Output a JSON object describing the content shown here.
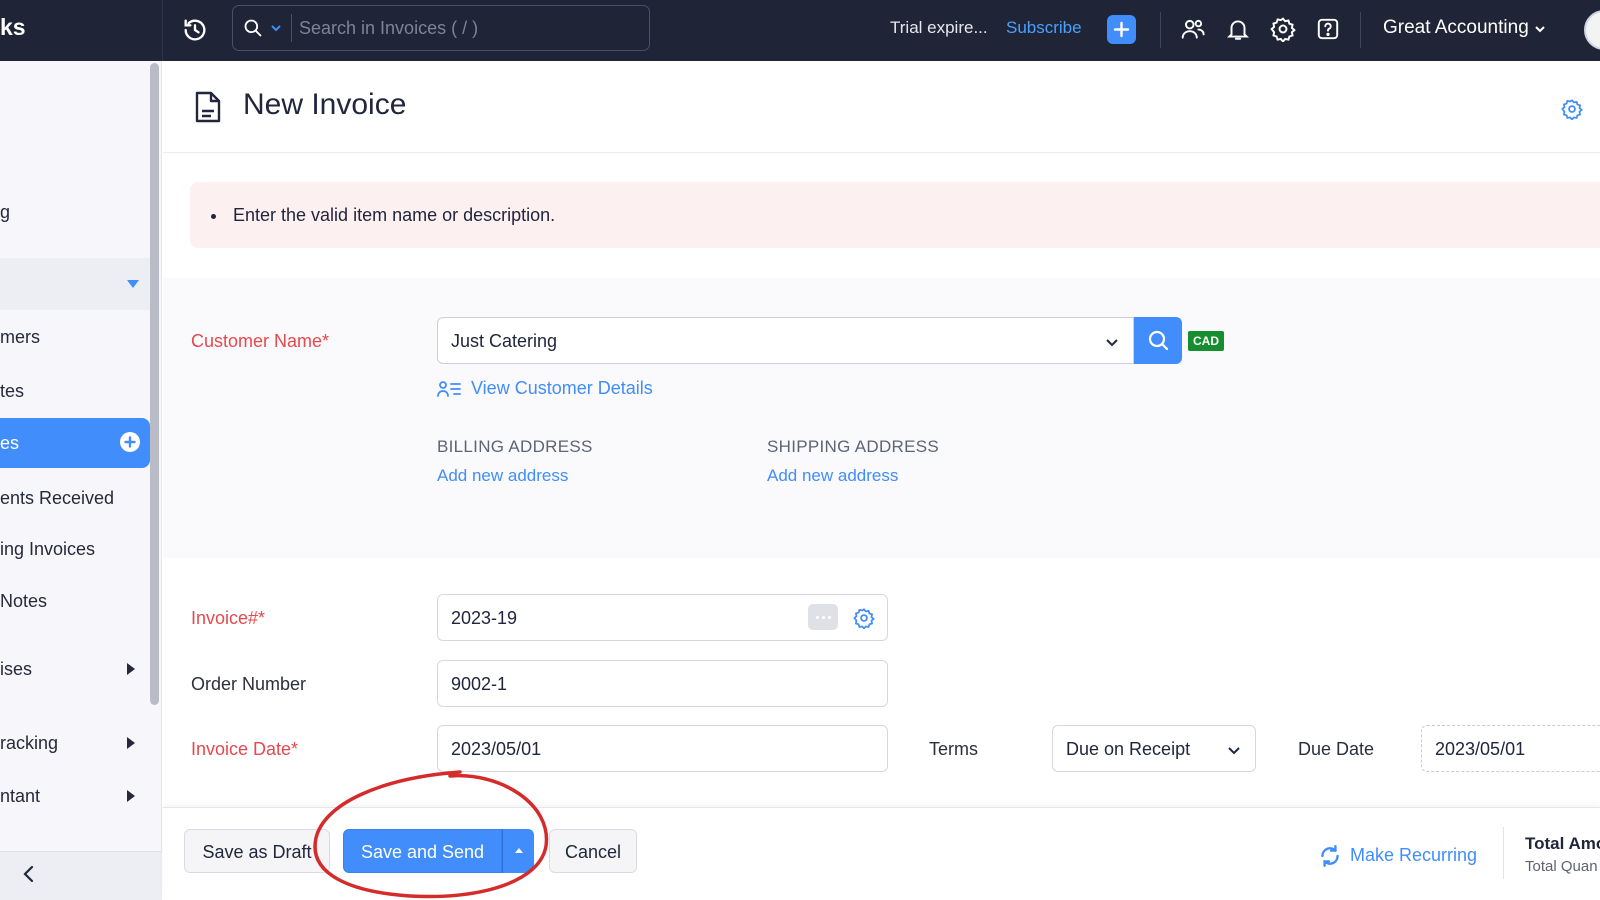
{
  "topbar": {
    "brand": "ks",
    "search_placeholder": "Search in Invoices ( / )",
    "trial_text": "Trial expire...",
    "subscribe_label": "Subscribe",
    "org_name": "Great Accounting"
  },
  "sidebar": {
    "items": [
      {
        "label": "g"
      },
      {
        "label": "mers"
      },
      {
        "label": "tes"
      },
      {
        "label": "es"
      },
      {
        "label": "ents Received"
      },
      {
        "label": "ing Invoices"
      },
      {
        "label": " Notes"
      },
      {
        "label": "ises"
      },
      {
        "label": "racking"
      },
      {
        "label": "ntant"
      }
    ]
  },
  "page": {
    "title": "New Invoice",
    "error_message": "Enter the valid item name or description."
  },
  "customer": {
    "label": "Customer Name*",
    "value": "Just Catering",
    "currency": "CAD",
    "view_details_label": "View Customer Details",
    "billing_title": "BILLING ADDRESS",
    "billing_link": "Add new address",
    "shipping_title": "SHIPPING ADDRESS",
    "shipping_link": "Add new address"
  },
  "invoice": {
    "number_label": "Invoice#*",
    "number_value": "2023-19",
    "order_label": "Order Number",
    "order_value": "9002-1",
    "date_label": "Invoice Date*",
    "date_value": "2023/05/01",
    "terms_label": "Terms",
    "terms_value": "Due on Receipt",
    "due_label": "Due Date",
    "due_value": "2023/05/01"
  },
  "footer": {
    "save_draft_label": "Save as Draft",
    "save_send_label": "Save and Send",
    "cancel_label": "Cancel",
    "recurring_label": "Make Recurring",
    "total_amount_label": "Total Amo",
    "total_quantity_label": "Total Quan"
  },
  "colors": {
    "accent": "#408dfb",
    "topbar": "#1f2536",
    "required": "#e5484d",
    "alert_bg": "#fdf0f0",
    "currency_badge": "#168e2f",
    "annotation": "#d62b2b"
  },
  "icons": [
    "history-icon",
    "search-icon",
    "plus-icon",
    "users-icon",
    "bell-icon",
    "gear-icon",
    "help-icon",
    "document-icon",
    "chevron-down-icon",
    "contact-card-icon",
    "more-icon",
    "refresh-icon",
    "chevron-left-icon"
  ]
}
